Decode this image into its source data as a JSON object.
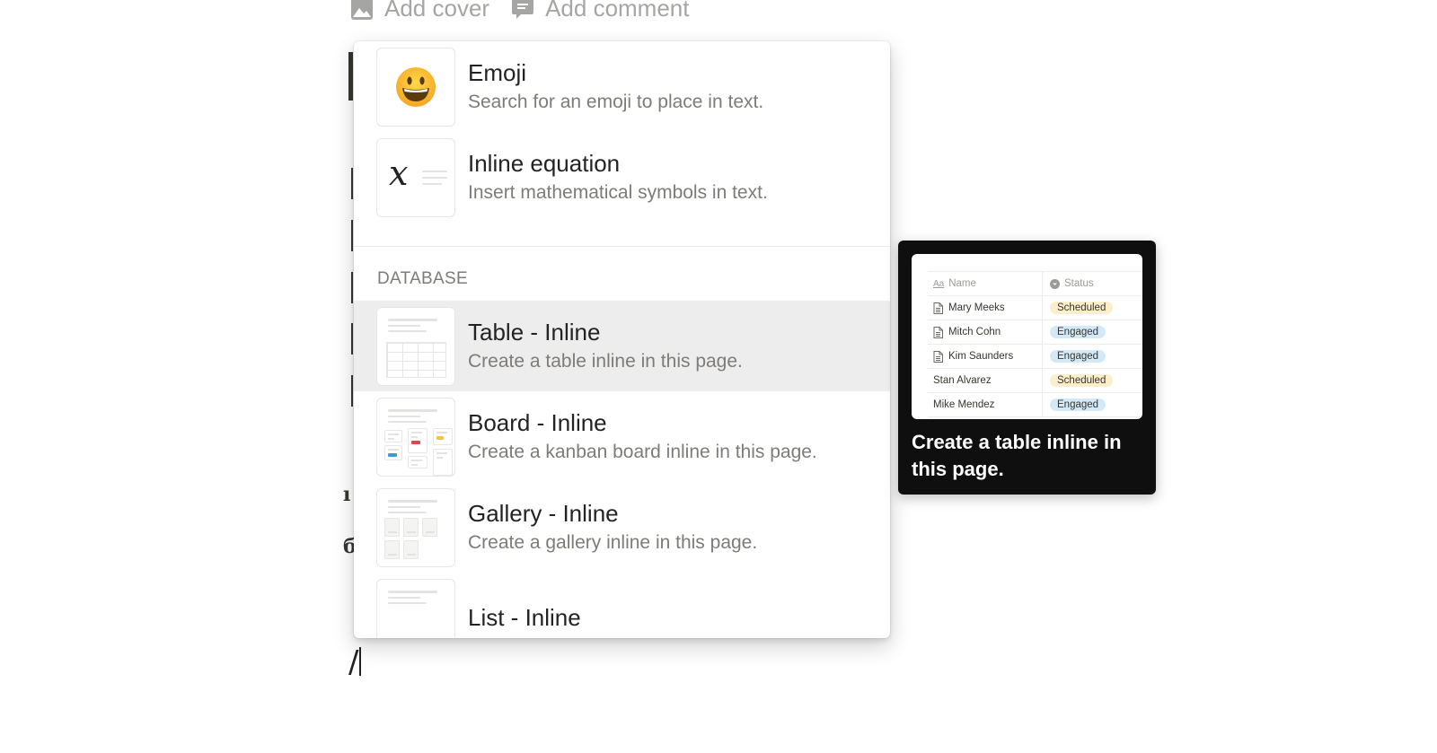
{
  "page_controls": {
    "add_cover": {
      "label": "Add cover",
      "icon": "image-icon"
    },
    "add_comment": {
      "label": "Add comment",
      "icon": "comment-icon"
    }
  },
  "editor": {
    "current_input": "/"
  },
  "menu": {
    "items_top": [
      {
        "title": "Emoji",
        "description": "Search for an emoji to place in text.",
        "icon": "emoji-icon",
        "glyph": "😃"
      },
      {
        "title": "Inline equation",
        "description": "Insert mathematical symbols in text.",
        "icon": "equation-icon",
        "glyph": "x"
      }
    ],
    "sections": [
      {
        "label": "DATABASE",
        "items": [
          {
            "title": "Table - Inline",
            "description": "Create a table inline in this page.",
            "icon": "table-thumbnail-icon",
            "active": true
          },
          {
            "title": "Board - Inline",
            "description": "Create a kanban board inline in this page.",
            "icon": "board-thumbnail-icon"
          },
          {
            "title": "Gallery - Inline",
            "description": "Create a gallery inline in this page.",
            "icon": "gallery-thumbnail-icon"
          },
          {
            "title": "List - Inline",
            "description": "",
            "icon": "list-thumbnail-icon"
          }
        ]
      }
    ]
  },
  "tooltip": {
    "caption": "Create a table inline in this page.",
    "preview": {
      "columns": [
        {
          "label": "Name",
          "icon": "text-property-icon"
        },
        {
          "label": "Status",
          "icon": "select-property-icon"
        }
      ],
      "rows": [
        {
          "name": "Mary Meeks",
          "status": "Scheduled",
          "has_page_icon": true
        },
        {
          "name": "Mitch Cohn",
          "status": "Engaged",
          "has_page_icon": true
        },
        {
          "name": "Kim Saunders",
          "status": "Engaged",
          "has_page_icon": true
        },
        {
          "name": "Stan Alvarez",
          "status": "Scheduled",
          "has_page_icon": false
        },
        {
          "name": "Mike Mendez",
          "status": "Engaged",
          "has_page_icon": false
        }
      ],
      "status_colors": {
        "Scheduled": "#fbeecb",
        "Engaged": "#d3e9f7"
      }
    }
  },
  "colors": {
    "active_item_bg": "#ededed",
    "tooltip_bg": "#0f0f0f",
    "board_tag_red": "#e0474a",
    "board_tag_blue": "#3a9bd9",
    "board_tag_yellow": "#f3c346"
  }
}
